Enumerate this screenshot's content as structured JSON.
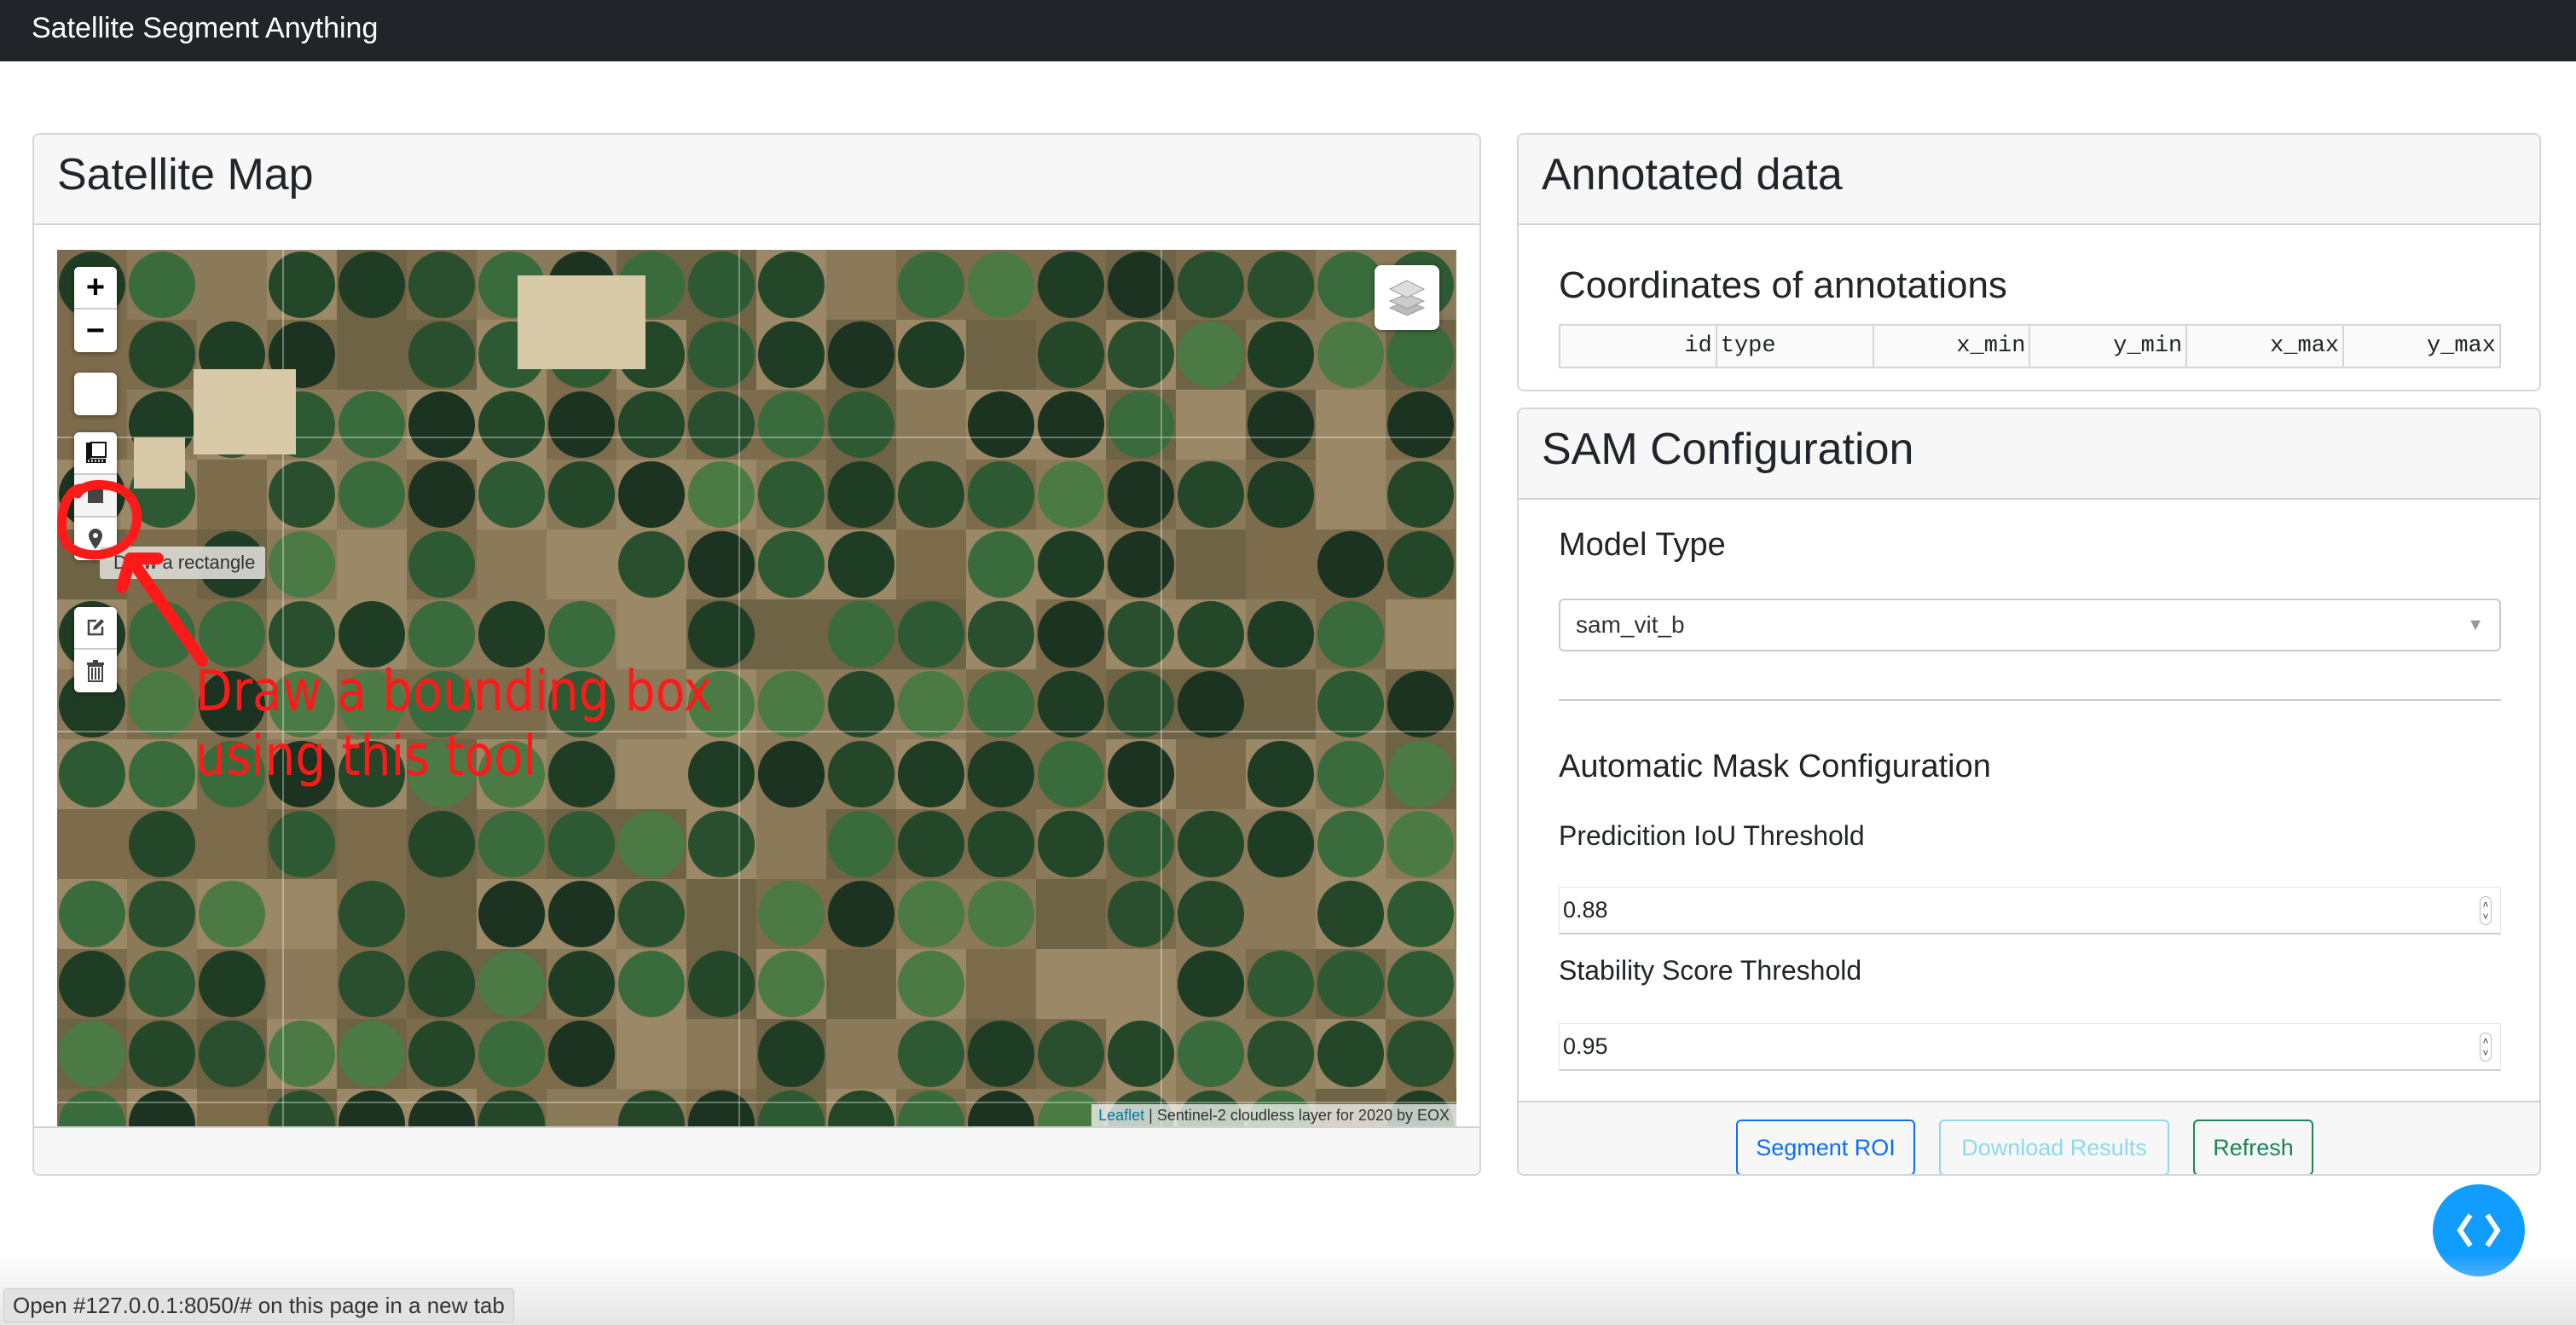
{
  "navbar": {
    "brand": "Satellite Segment Anything"
  },
  "map_card": {
    "title": "Satellite Map",
    "map": {
      "zoom_in_label": "+",
      "zoom_out_label": "−",
      "tooltip": "Draw a rectangle",
      "annotation_text_line1": "Draw a bounding box",
      "annotation_text_line2": "using this tool",
      "annotation_color": "#ff1a1a",
      "attribution_link": "Leaflet",
      "attribution_separator": " | ",
      "attribution_text": "Sentinel-2 cloudless layer for 2020 by EOX",
      "icons": [
        "plus-icon",
        "minus-icon",
        "ruler-icon",
        "rectangle-icon",
        "marker-icon",
        "edit-icon",
        "trash-icon",
        "layers-icon"
      ]
    }
  },
  "annotated_card": {
    "title": "Annotated data",
    "table_title": "Coordinates of annotations",
    "columns": [
      "id",
      "type",
      "x_min",
      "y_min",
      "x_max",
      "y_max"
    ],
    "rows": []
  },
  "sam_card": {
    "title": "SAM Configuration",
    "model_type_label": "Model Type",
    "model_type_value": "sam_vit_b",
    "auto_mask_title": "Automatic Mask Configuration",
    "iou_label": "Predicition IoU Threshold",
    "iou_value": "0.88",
    "stability_label": "Stability Score Threshold",
    "stability_value": "0.95",
    "buttons": {
      "segment": "Segment ROI",
      "download": "Download Results",
      "refresh": "Refresh"
    },
    "colors": {
      "segment": "#0d6efd",
      "download": "#8fd9ec",
      "refresh": "#198754"
    }
  },
  "status_bar": {
    "text": "Open #127.0.0.1:8050/# on this page in a new tab"
  },
  "fab": {
    "icon": "code-brackets-icon",
    "color": "#119dff"
  }
}
